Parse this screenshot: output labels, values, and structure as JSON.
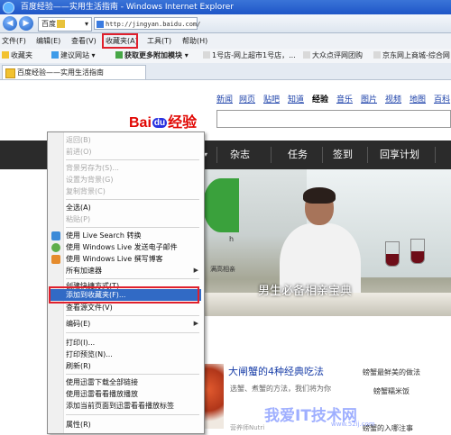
{
  "window": {
    "title": "百度经验——实用生活指南 - Windows Internet Explorer"
  },
  "address_bar": {
    "search_engine": "百度",
    "url": "http://jingyan.baidu.com/"
  },
  "menubar": {
    "items": [
      "文件(F)",
      "编辑(E)",
      "查看(V)",
      "收藏夹(A)",
      "工具(T)",
      "帮助(H)"
    ]
  },
  "favorites_bar": {
    "favorites_label": "收藏夹",
    "items": [
      "建议网站 ▾",
      "获取更多附加模块 ▾",
      "1号店-网上超市1号店，...",
      "大众点评网团购",
      "京东网上商城-综合网"
    ]
  },
  "tab": {
    "title": "百度经验——实用生活指南"
  },
  "page": {
    "top_links": [
      "新闻",
      "网页",
      "贴吧",
      "知道",
      "经验",
      "音乐",
      "图片",
      "视频",
      "地图",
      "百科"
    ],
    "current_link": "经验",
    "logo": {
      "bai": "Bai",
      "du": "du",
      "jingyan": "经验"
    },
    "nav": [
      "杂志",
      "任务",
      "签到",
      "回享计划"
    ],
    "banner_caption": "男生必备相亲宝典",
    "green_panel_text": "h",
    "green_sub": "满高相亲",
    "article": {
      "title": "大闸蟹的4种经典吃法",
      "desc": "选蟹、煮蟹的方法，我们将为你",
      "meta": "营养师Nutri"
    },
    "side_links": [
      "螃蟹最鲜美的做法",
      "螃蟹糯米饭",
      "螃蟹的入哪注事"
    ]
  },
  "context_menu": {
    "items": [
      {
        "label": "返回(B)",
        "disabled": true
      },
      {
        "label": "前进(O)",
        "disabled": true
      },
      {
        "sep": true
      },
      {
        "label": "背景另存为(S)...",
        "disabled": true
      },
      {
        "label": "设置为背景(G)",
        "disabled": true
      },
      {
        "label": "复制背景(C)",
        "disabled": true
      },
      {
        "sep": true
      },
      {
        "label": "全选(A)"
      },
      {
        "label": "粘贴(P)",
        "disabled": true
      },
      {
        "sep": true
      },
      {
        "label": "使用 Live Search 转换",
        "icon": "live-search-icon"
      },
      {
        "label": "使用 Windows Live 发送电子邮件",
        "icon": "live-mail-icon"
      },
      {
        "label": "使用 Windows Live 撰写博客",
        "icon": "live-blog-icon"
      },
      {
        "label": "所有加速器",
        "submenu": true
      },
      {
        "sep": true
      },
      {
        "label": "创建快捷方式(T)"
      },
      {
        "label": "添加到收藏夹(F)...",
        "highlighted": true
      },
      {
        "label": "查看源文件(V)"
      },
      {
        "sep": true
      },
      {
        "label": "编码(E)",
        "submenu": true
      },
      {
        "sep": true
      },
      {
        "label": "打印(I)..."
      },
      {
        "label": "打印预览(N)..."
      },
      {
        "label": "刷新(R)"
      },
      {
        "sep": true
      },
      {
        "label": "使用迅雷下载全部链接"
      },
      {
        "label": "使用迅雷看看播放播放"
      },
      {
        "label": "添加当前页面到迅雷看看播放标签"
      },
      {
        "sep": true
      },
      {
        "label": "属性(R)"
      }
    ]
  },
  "watermark": {
    "text": "我爱IT技术网",
    "url": "www.52ij.com"
  },
  "colors": {
    "highlight": "#316ac5",
    "annotation_red": "#e0202c",
    "baidu_red": "#e10602",
    "baidu_blue": "#2932e1"
  }
}
